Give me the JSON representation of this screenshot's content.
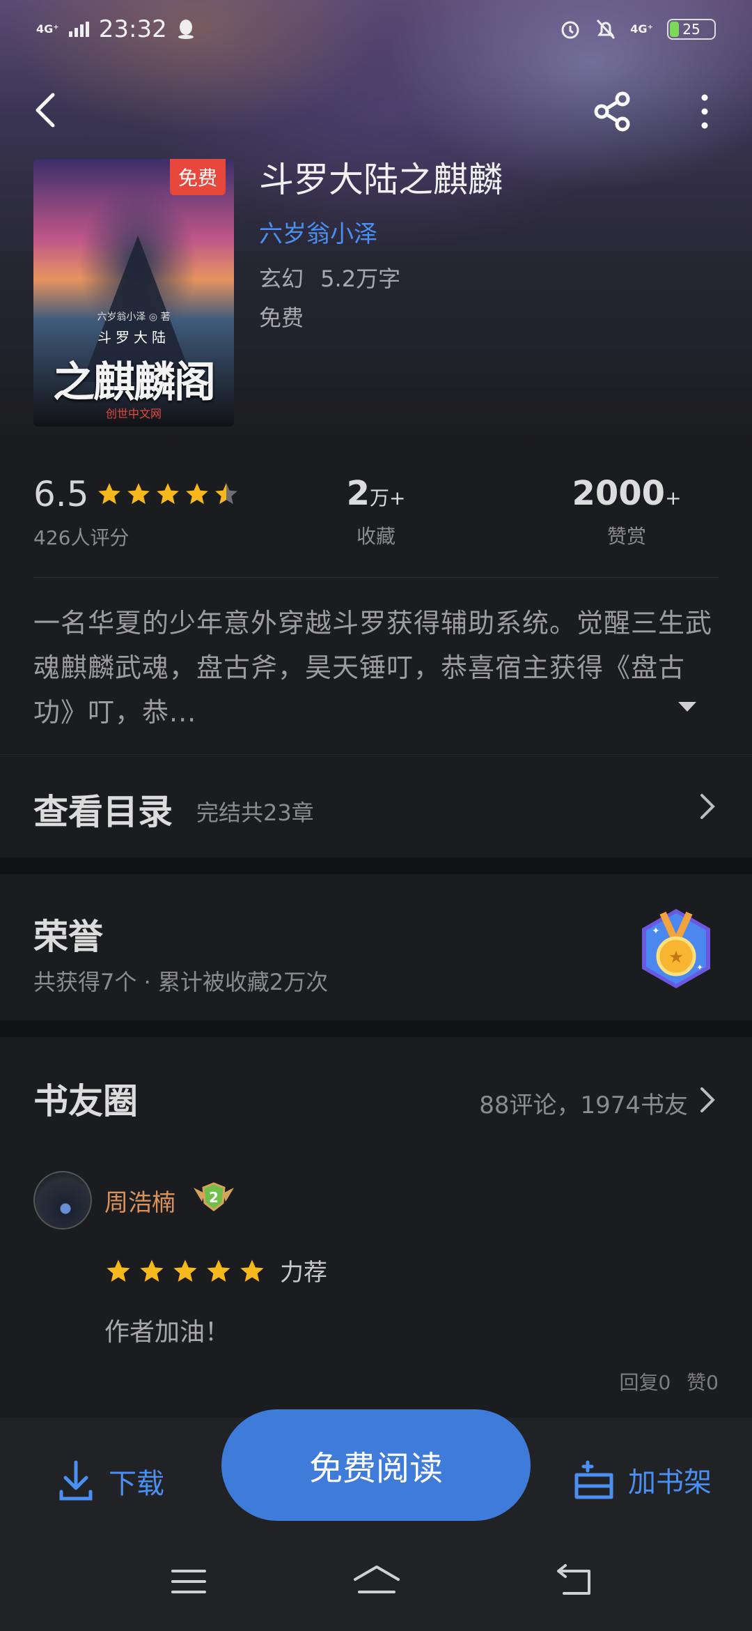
{
  "status_bar": {
    "time": "23:32",
    "network": "4G⁺",
    "battery": "25"
  },
  "book": {
    "cover_badge": "免费",
    "cover_author": "六岁翁小泽 ◎ 著",
    "cover_series": "斗罗大陆",
    "cover_title": "之麒麟阁",
    "cover_publisher": "创世中文网",
    "title": "斗罗大陆之麒麟",
    "author": "六岁翁小泽",
    "meta": "玄幻 5.2万字",
    "price": "免费"
  },
  "stats": {
    "score": "6.5",
    "rating_stars": 4.5,
    "score_label": "426人评分",
    "collect_num": "2",
    "collect_unit": "万+",
    "collect_label": "收藏",
    "reward_num": "2000",
    "reward_unit": "+",
    "reward_label": "赞赏"
  },
  "synopsis": "一名华夏的少年意外穿越斗罗获得辅助系统。觉醒三生武魂麒麟武魂，盘古斧，昊天锤叮，恭喜宿主获得《盘古功》叮，恭...",
  "toc": {
    "title": "查看目录",
    "subtitle": "完结共23章"
  },
  "honor": {
    "title": "荣誉",
    "subtitle": "共获得7个 · 累计被收藏2万次"
  },
  "circle": {
    "title": "书友圈",
    "meta": "88评论，1974书友",
    "comment": {
      "user": "周浩楠",
      "level": "2",
      "stars": 5,
      "tag": "力荐",
      "text": "作者加油！",
      "actions": "回复0 赞0"
    }
  },
  "bottom": {
    "download": "下载",
    "read": "免费阅读",
    "shelf": "加书架"
  },
  "colors": {
    "accent": "#4a8ff2",
    "button": "#3f7bd8",
    "star": "#f6b81c",
    "badge": "#e8473b"
  }
}
